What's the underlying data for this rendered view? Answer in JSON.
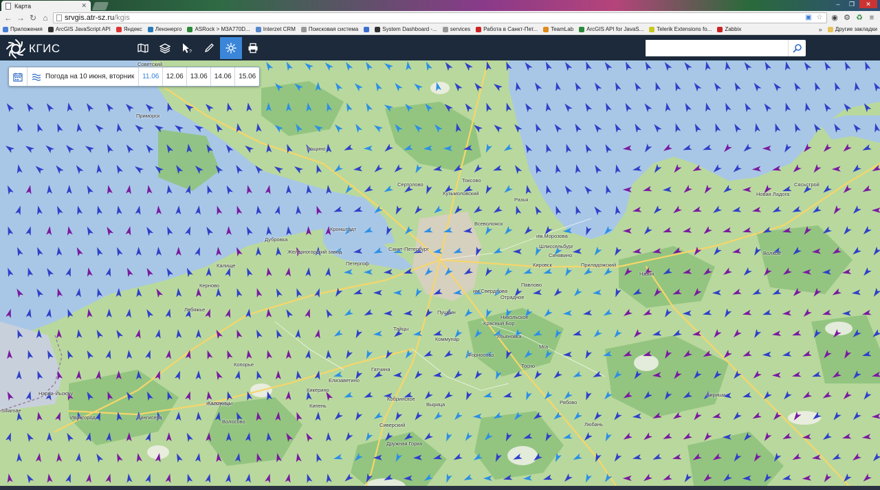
{
  "browser": {
    "tab_title": "Карта",
    "url_host": "srvgis.atr-sz.ru",
    "url_path": "/kgis",
    "bookmarks": [
      {
        "label": "Приложения",
        "color": "#4a7fd6"
      },
      {
        "label": "ArcGIS JavaScript API",
        "color": "#333333"
      },
      {
        "label": "Яндекс",
        "color": "#d33"
      },
      {
        "label": "Ленэнерго",
        "color": "#2a7ab8"
      },
      {
        "label": "ASRock > M3A770D...",
        "color": "#2a8a3a"
      },
      {
        "label": "Interzet CRM",
        "color": "#5588cc"
      },
      {
        "label": "Поисковая система",
        "color": "#999999"
      },
      {
        "label": "",
        "color": "#3a6fcf"
      },
      {
        "label": "System Dashboard -...",
        "color": "#333333"
      },
      {
        "label": "services",
        "color": "#999999"
      },
      {
        "label": "Работа в Санкт-Пет...",
        "color": "#c22"
      },
      {
        "label": "TeamLab",
        "color": "#e08a1a"
      },
      {
        "label": "ArcGIS API for JavaS...",
        "color": "#2a8a3a"
      },
      {
        "label": "Telerik Extensions fo...",
        "color": "#c8c820"
      },
      {
        "label": "Zabbix",
        "color": "#c22"
      }
    ],
    "bookmarks_more": "»",
    "other_bookmarks": "Другие закладки"
  },
  "app": {
    "logo_text": "КГИС",
    "search_placeholder": "",
    "tools": [
      "map-icon",
      "layers-icon",
      "identify-pointer-icon",
      "pencil-icon",
      "weather-sun-icon",
      "print-icon"
    ],
    "active_tool": "weather-sun-icon"
  },
  "weather_panel": {
    "title": "Погода на 10 июня, вторник",
    "days": [
      "11.06",
      "12.06",
      "13.06",
      "14.06",
      "15.06"
    ],
    "active_day": "11.06"
  },
  "map": {
    "places": [
      "Советский",
      "Приморск",
      "Рощино",
      "Сертолово",
      "Токсово",
      "Кузьмоловский",
      "Разья",
      "Всеволожск",
      "им.Морозова",
      "Кронштадт",
      "Санкт-Петербург",
      "Шлиссельбург",
      "Кировск",
      "Синявино",
      "Приладожский",
      "Назия",
      "Волхов",
      "Новая Ладога",
      "Сясьстрой",
      "Дубровка",
      "Железногорский завод",
      "Петергоф",
      "Калище",
      "Керново",
      "Лебяжье",
      "Копорье",
      "им.Свердлова",
      "Павлово",
      "Отрадное",
      "Пушкин",
      "Красный Бор",
      "Никольское",
      "Ульяновка",
      "Коммунар",
      "Тосно",
      "Форносово",
      "Тайцы",
      "Гатчина",
      "Елизаветино",
      "Кикерино",
      "Волосово",
      "Кипень",
      "Вырица",
      "Сиверский",
      "Коммунар",
      "Мга",
      "Кириши",
      "Рябово",
      "Любань",
      "Нарва-Йыэсуу",
      "Sillamäe",
      "Ивангород",
      "Кингисепп",
      "Каложицы",
      "Дружная Горка",
      "Кобринское"
    ],
    "colors": {
      "water": "#a8c8e8",
      "land": "#b8d79c",
      "forest": "#8fc27c",
      "arrow_blue": "#2f40c8",
      "arrow_purple": "#7a1aa0",
      "arrow_light": "#2c8fe6"
    }
  }
}
